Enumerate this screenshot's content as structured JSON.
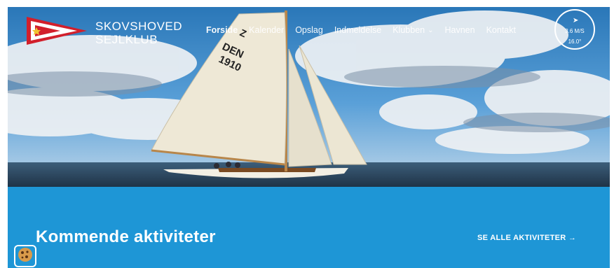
{
  "brand": {
    "line1": "SKOVSHOVED",
    "line2": "SEJLKLUB",
    "logo_icon": "club-burgee-icon"
  },
  "nav": {
    "items": [
      {
        "label": "Forside",
        "active": true
      },
      {
        "label": "Kalender"
      },
      {
        "label": "Opslag"
      },
      {
        "label": "Indmeldelse"
      },
      {
        "label": "Klubben",
        "has_dropdown": true
      },
      {
        "label": "Havnen"
      },
      {
        "label": "Kontakt"
      }
    ]
  },
  "wind": {
    "speed": "3.6 M/S",
    "direction": "16.0°",
    "icon": "wind-arrow-icon"
  },
  "hero": {
    "sail_text": "Z DEN 1910"
  },
  "activities": {
    "title": "Kommende aktiviteter",
    "see_all": "SE ALLE AKTIVITETER →"
  },
  "cookie": {
    "icon": "cookie-icon"
  },
  "colors": {
    "accent": "#1e96d6",
    "text": "#ffffff"
  }
}
